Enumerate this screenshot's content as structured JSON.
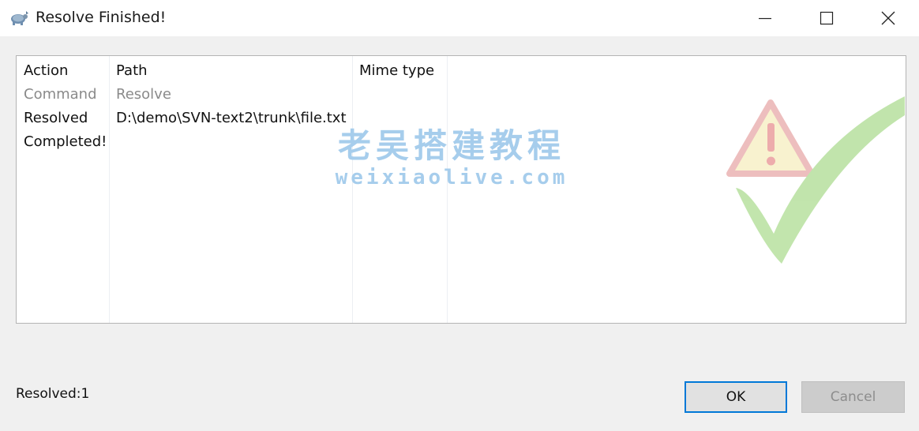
{
  "window": {
    "title": "Resolve Finished!",
    "icon": "tortoise-svn-icon",
    "controls": {
      "minimize": "minimize-icon",
      "maximize": "maximize-icon",
      "close": "close-icon"
    }
  },
  "list": {
    "columns": [
      "Action",
      "Path",
      "Mime type"
    ],
    "rows": [
      {
        "action": "Command",
        "path": "Resolve",
        "mime": "",
        "style": "gray"
      },
      {
        "action": "Resolved",
        "path": "D:\\demo\\SVN-text2\\trunk\\file.txt",
        "mime": "",
        "style": "normal"
      },
      {
        "action": "Completed!",
        "path": "",
        "mime": "",
        "style": "normal"
      }
    ]
  },
  "watermark": {
    "title": "老吴搭建教程",
    "url": "weixiaolive.com",
    "icon": "success-check-warning-icon"
  },
  "status": {
    "text": "Resolved:1"
  },
  "buttons": {
    "ok": "OK",
    "cancel": "Cancel"
  },
  "colors": {
    "accent": "#0078d7",
    "watermark": "#a6cdec",
    "check_green": "#7cc24a",
    "warning_red": "#d9534f",
    "muted_text": "#8a8a8a"
  }
}
